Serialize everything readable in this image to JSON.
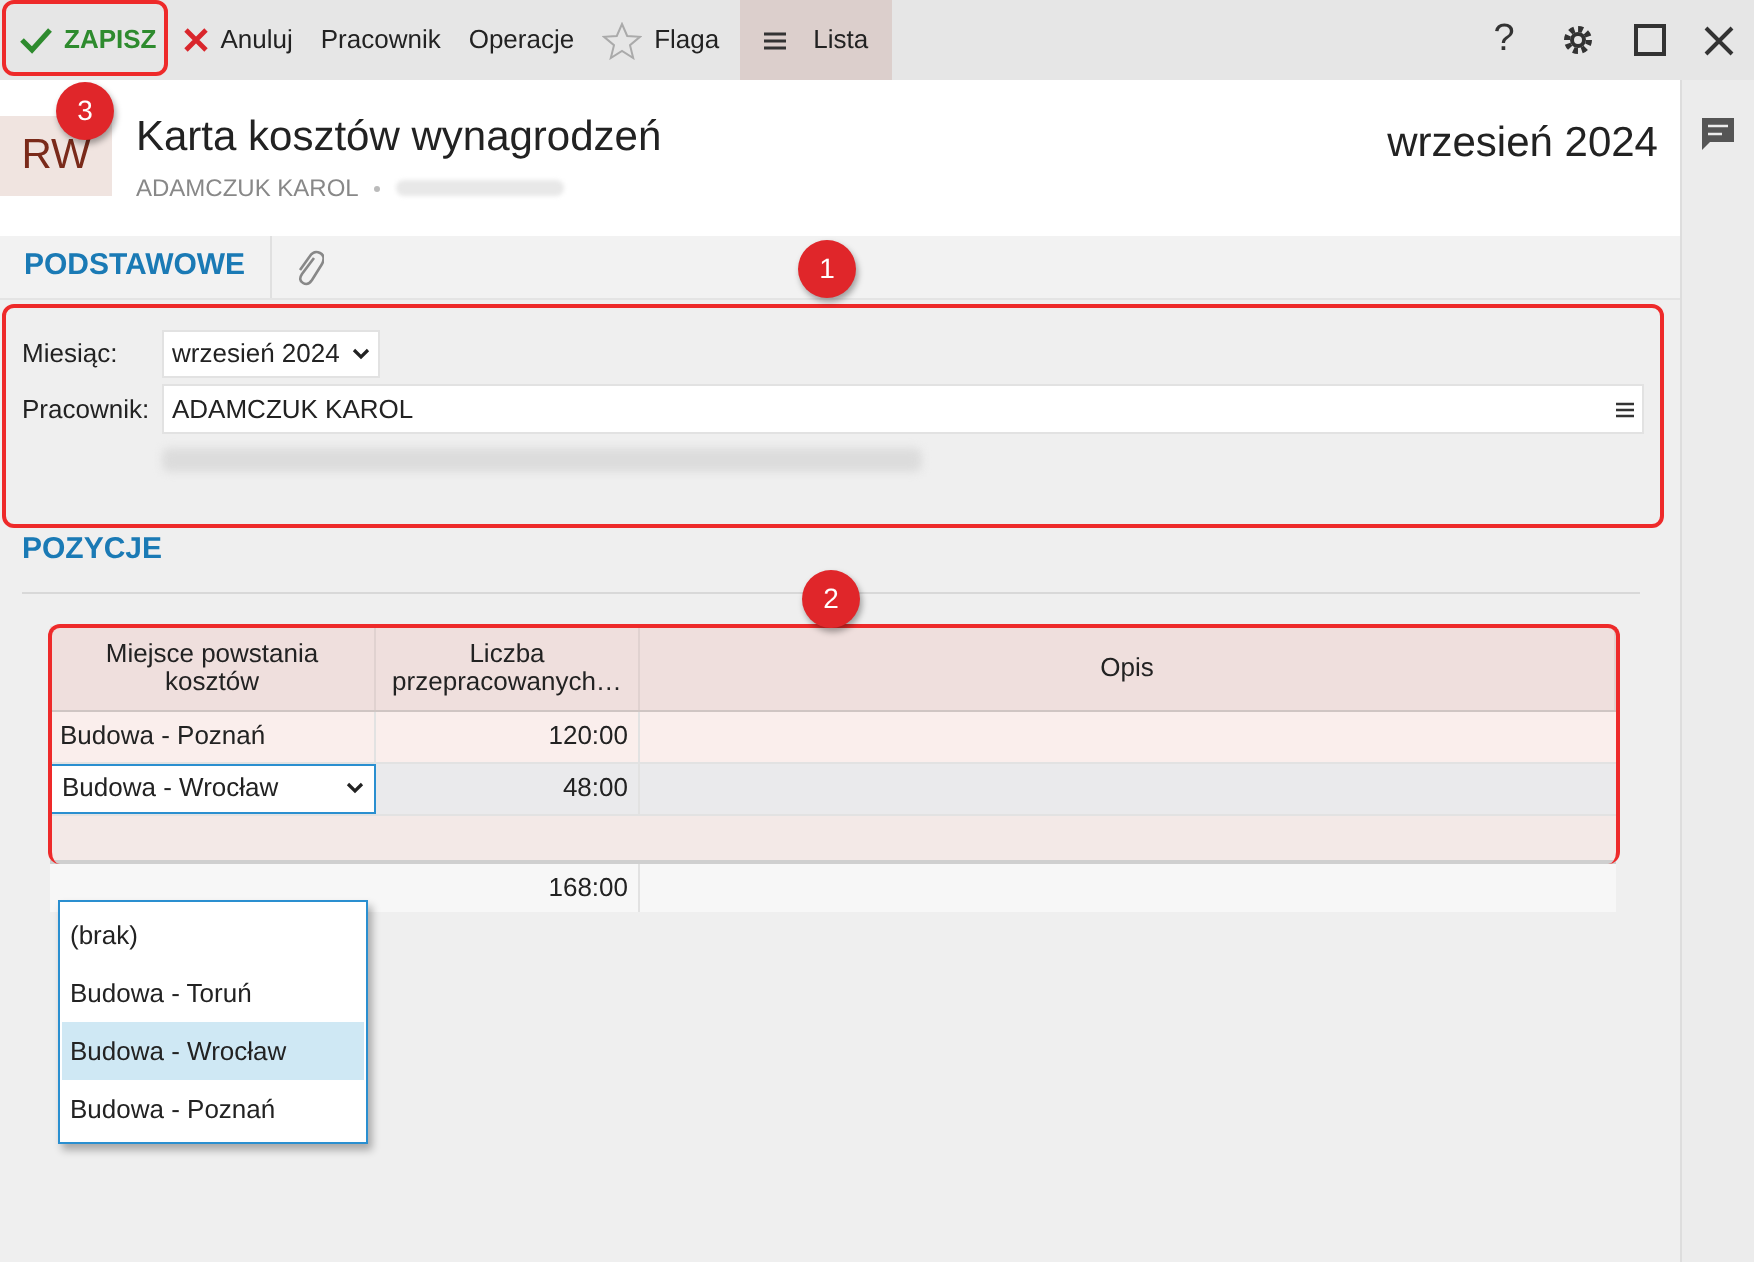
{
  "toolbar": {
    "buttons": [
      {
        "kind": "save",
        "label": "ZAPISZ",
        "selected": false
      },
      {
        "kind": "cancel",
        "label": "Anuluj",
        "selected": false
      },
      {
        "kind": "plain",
        "label": "Pracownik",
        "selected": false
      },
      {
        "kind": "plain",
        "label": "Operacje",
        "selected": false
      },
      {
        "kind": "flag",
        "label": "Flaga",
        "selected": false
      },
      {
        "kind": "list",
        "label": "Lista",
        "selected": true
      }
    ],
    "help": "?"
  },
  "header": {
    "badge": "RW",
    "title": "Karta kosztów wynagrodzeń",
    "subtitle": "ADAMCZUK KAROL",
    "period": "wrzesień 2024"
  },
  "tabs": [
    {
      "label": "PODSTAWOWE",
      "selected": true
    }
  ],
  "form": {
    "month_label": "Miesiąc:",
    "month_value": "wrzesień 2024",
    "employee_label": "Pracownik:",
    "employee_value": "ADAMCZUK KAROL"
  },
  "section_title": "POZYCJE",
  "table": {
    "columns": [
      "Miejsce powstania kosztów",
      "Liczba przepracowanych…",
      "Opis"
    ],
    "rows": [
      {
        "place": "Budowa - Poznań",
        "hours": "120:00",
        "editing": false
      },
      {
        "place": "Budowa - Wrocław",
        "hours": "48:00",
        "editing": true
      }
    ],
    "total": "168:00"
  },
  "dropdown": {
    "options": [
      {
        "label": "(brak)",
        "selected": false
      },
      {
        "label": "Budowa - Toruń",
        "selected": false
      },
      {
        "label": "Budowa - Wrocław",
        "selected": true
      },
      {
        "label": "Budowa - Poznań",
        "selected": false
      }
    ]
  },
  "callouts": [
    {
      "label": "1"
    },
    {
      "label": "2"
    },
    {
      "label": "3"
    }
  ]
}
